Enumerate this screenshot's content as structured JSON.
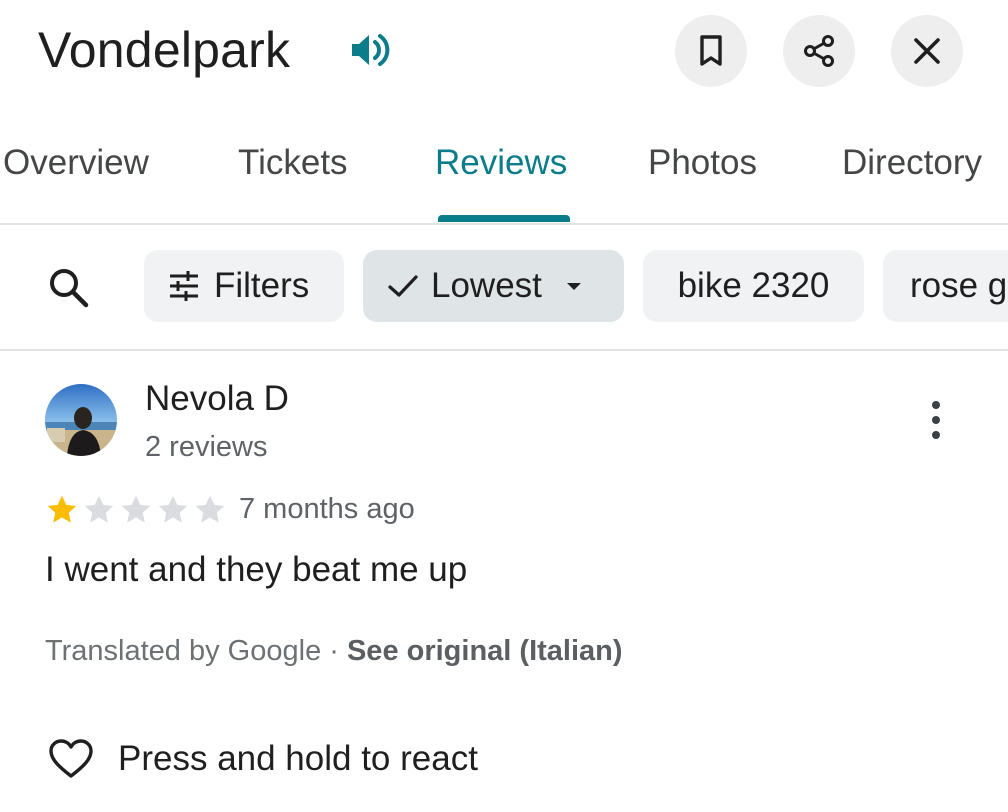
{
  "place": {
    "title": "Vondelpark"
  },
  "header": {
    "speaker_icon": "volume-icon",
    "actions": [
      {
        "name": "save",
        "icon": "bookmark-icon"
      },
      {
        "name": "share",
        "icon": "share-icon"
      },
      {
        "name": "close",
        "icon": "close-icon"
      }
    ]
  },
  "tabs": [
    {
      "label": "Overview",
      "active": false
    },
    {
      "label": "Tickets",
      "active": false
    },
    {
      "label": "Reviews",
      "active": true
    },
    {
      "label": "Photos",
      "active": false
    },
    {
      "label": "Directory",
      "active": false
    }
  ],
  "chips": {
    "filters_label": "Filters",
    "sort_label": "Lowest",
    "topic1_label": "bike 2320",
    "topic2_label": "rose g"
  },
  "review": {
    "author": "Nevola D",
    "author_meta": "2 reviews",
    "rating": 1,
    "max_rating": 5,
    "time": "7 months ago",
    "text": "I went and they beat me up",
    "translated_by": "Translated by Google · ",
    "see_original": "See original (Italian)",
    "react_label": "Press and hold to react"
  },
  "colors": {
    "accent": "#0b7c8a",
    "star_filled": "#fbbc04",
    "star_empty": "#dadce0",
    "chip_bg": "#f0f2f3",
    "chip_selected_bg": "#dfe4e6",
    "divider": "#e3e3e3"
  }
}
